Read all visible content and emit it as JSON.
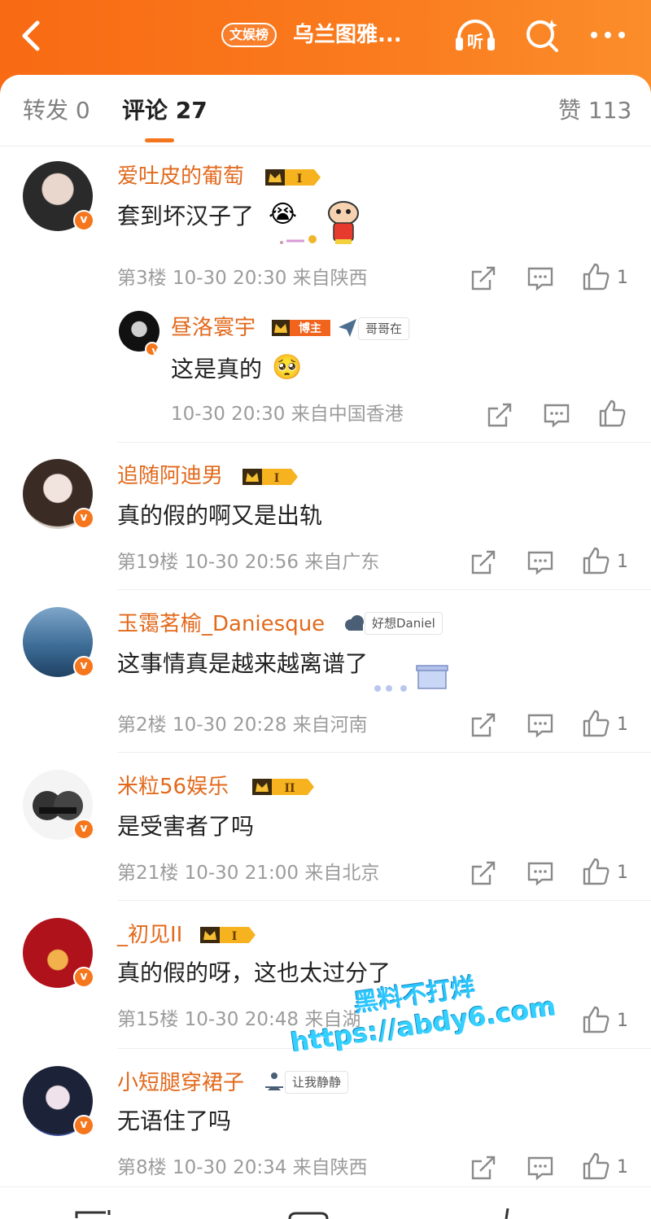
{
  "header": {
    "tag": "文娱榜",
    "title": "乌兰图雅...",
    "listen_label": "听"
  },
  "tabs": {
    "repost": "转发 0",
    "comments": "评论 27",
    "likes": "赞 113"
  },
  "comments": [
    {
      "user": "爱吐皮的葡萄",
      "level": "I",
      "text": "套到坏汉子了",
      "meta": "第3楼 10-30 20:30 来自陕西",
      "likes": "1"
    },
    {
      "user": "昼洛寰宇",
      "badge": "博主",
      "tag": "哥哥在",
      "text": "这是真的",
      "meta": "10-30 20:30 来自中国香港"
    },
    {
      "user": "追随阿迪男",
      "level": "I",
      "text": "真的假的啊又是出轨",
      "meta": "第19楼 10-30 20:56 来自广东",
      "likes": "1"
    },
    {
      "user": "玉霭茗榆_Daniesque",
      "tag": "好想Daniel",
      "text": "这事情真是越来越离谱了",
      "meta": "第2楼 10-30 20:28 来自河南",
      "likes": "1"
    },
    {
      "user": "米粒56娱乐",
      "level": "II",
      "text": "是受害者了吗",
      "meta": "第21楼 10-30 21:00 来自北京",
      "likes": "1"
    },
    {
      "user": "_初见II",
      "level": "I",
      "text": "真的假的呀，这也太过分了",
      "meta": "第15楼 10-30 20:48 来自湖",
      "likes": "1"
    },
    {
      "user": "小短腿穿裙子",
      "tag": "让我静静",
      "text": "无语住了吗",
      "meta": "第8楼 10-30 20:34 来自陕西",
      "likes": "1"
    }
  ],
  "watermark": {
    "line1": "黑料不打烊",
    "line2": "https://abdy6.com"
  },
  "colors": {
    "brand_orange": "#f86a13",
    "username_orange": "#e2691c"
  }
}
